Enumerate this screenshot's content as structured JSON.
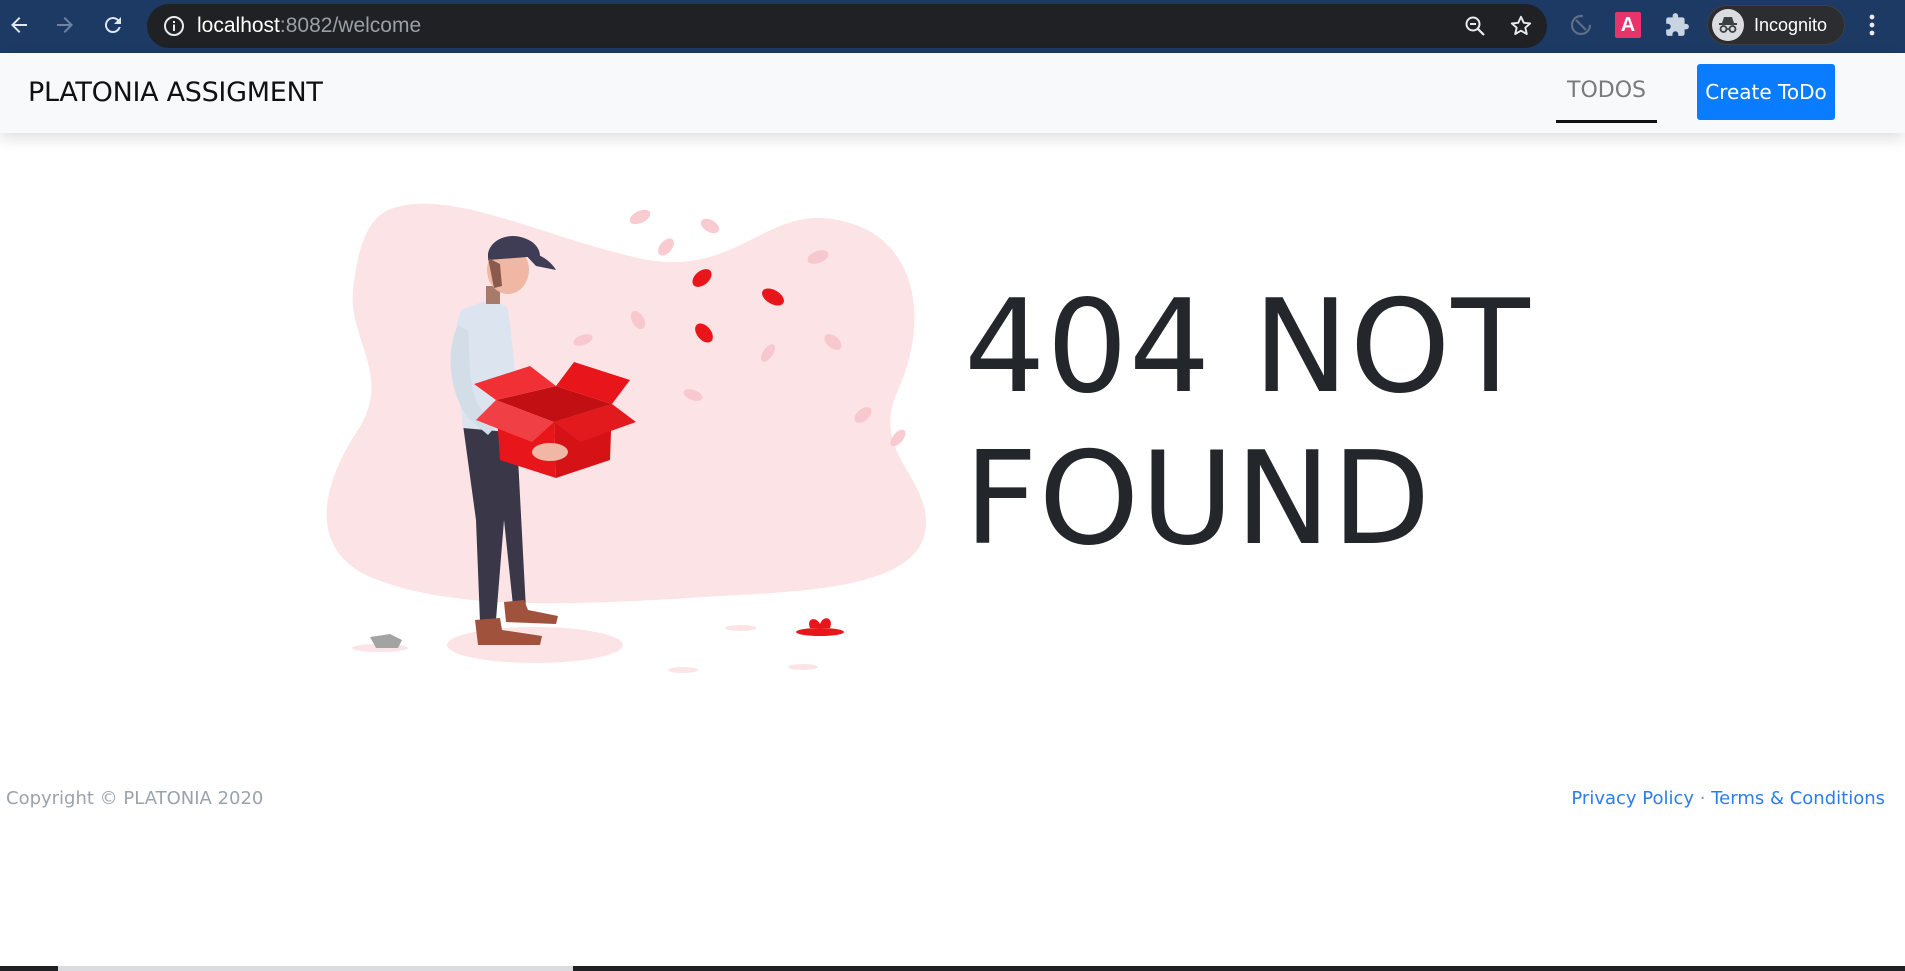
{
  "browser": {
    "url_host": "localhost",
    "url_rest": ":8082/welcome",
    "profile_label": "Incognito",
    "extension_badge": "A",
    "icons": [
      "back-icon",
      "forward-icon",
      "reload-icon",
      "info-icon",
      "zoom-icon",
      "star-icon",
      "sync-icon",
      "extension-a-icon",
      "puzzle-icon",
      "incognito-icon",
      "menu-dots-icon"
    ]
  },
  "navbar": {
    "brand": "PLATONIA ASSIGMENT",
    "nav_todos": "TODOS",
    "create_button": "Create ToDo"
  },
  "main": {
    "headline_line1": "404 NOT",
    "headline_line2": "FOUND"
  },
  "footer": {
    "copyright": "Copyright © PLATONIA 2020",
    "privacy": "Privacy Policy",
    "separator": " · ",
    "terms": "Terms & Conditions"
  },
  "colors": {
    "chrome_bg": "#1c3a63",
    "omnibox_bg": "#202124",
    "navbar_bg": "#f8f9fa",
    "accent_button": "#0a7cff",
    "illustration_red": "#e8161b",
    "blob_pink": "#fce4e6",
    "link_blue": "#2b7de9"
  }
}
